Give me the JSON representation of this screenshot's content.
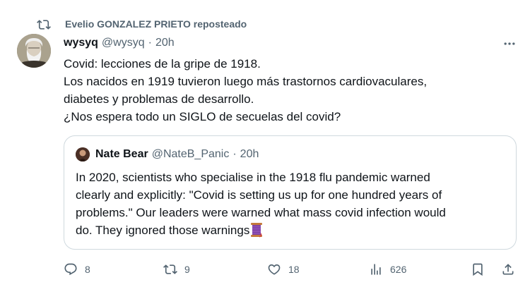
{
  "repost": {
    "text": "Evelio GONZALEZ PRIETO reposteado",
    "icon": "repost-icon"
  },
  "tweet": {
    "display_name": "wysyq",
    "handle": "@wysyq",
    "separator": "·",
    "time": "20h",
    "more_icon": "more-icon",
    "lines": [
      "Covid: lecciones de la gripe de 1918.",
      "Los nacidos en 1919 tuvieron luego más trastornos cardiovaculares,",
      "diabetes y problemas de desarrollo.",
      "¿Nos espera todo un SIGLO de secuelas del covid?"
    ]
  },
  "quote": {
    "display_name": "Nate Bear",
    "handle": "@NateB_Panic",
    "separator": "·",
    "time": "20h",
    "lines": [
      "In 2020, scientists who specialise in the 1918 flu pandemic warned",
      "clearly and explicitly: \"Covid is setting us up for one hundred years of",
      "problems.\" Our leaders were warned what mass covid infection would",
      "do. They ignored those warnings"
    ],
    "emoji": "thread-spool-emoji"
  },
  "actions": {
    "reply_count": "8",
    "retweet_count": "9",
    "like_count": "18",
    "views_count": "626"
  },
  "colors": {
    "text": "#0f1419",
    "secondary": "#536471",
    "border": "#cfd9de"
  }
}
